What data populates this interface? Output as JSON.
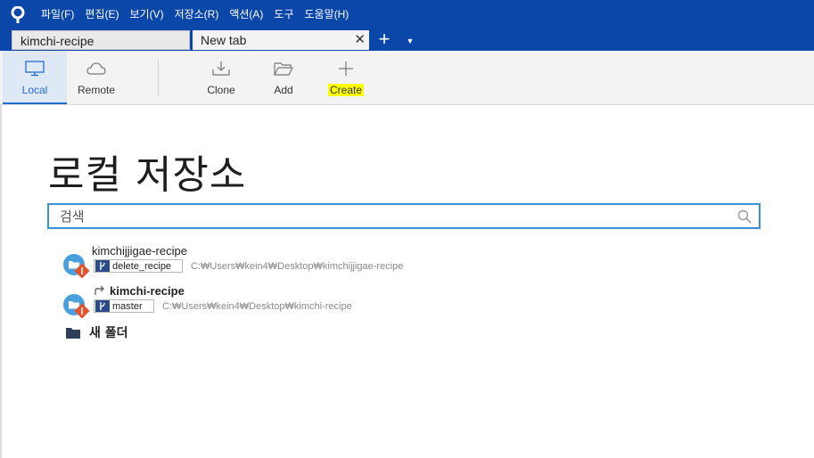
{
  "menu": {
    "items": [
      "파일(F)",
      "편집(E)",
      "보기(V)",
      "저장소(R)",
      "액션(A)",
      "도구",
      "도움말(H)"
    ]
  },
  "tabs": [
    {
      "label": "kimchi-recipe",
      "active": false
    },
    {
      "label": "New tab",
      "active": true
    }
  ],
  "toolbar": {
    "local_label": "Local",
    "remote_label": "Remote",
    "clone_label": "Clone",
    "add_label": "Add",
    "create_label": "Create"
  },
  "main": {
    "title": "로컬 저장소",
    "search_placeholder": "검색"
  },
  "repos": [
    {
      "name": "kimchijjigae-recipe",
      "branch": "delete_recipe",
      "path": "C:₩Users₩kein4₩Desktop₩kimchijjigae-recipe"
    },
    {
      "name": "kimchi-recipe",
      "branch": "master",
      "path": "C:₩Users₩kein4₩Desktop₩kimchi-recipe"
    }
  ],
  "folder": {
    "label": "새 폴더"
  },
  "colors": {
    "titlebar": "#0a47a9",
    "accent": "#1e6fd0",
    "highlight": "#ffff00",
    "git_badge": "#e4532b"
  }
}
